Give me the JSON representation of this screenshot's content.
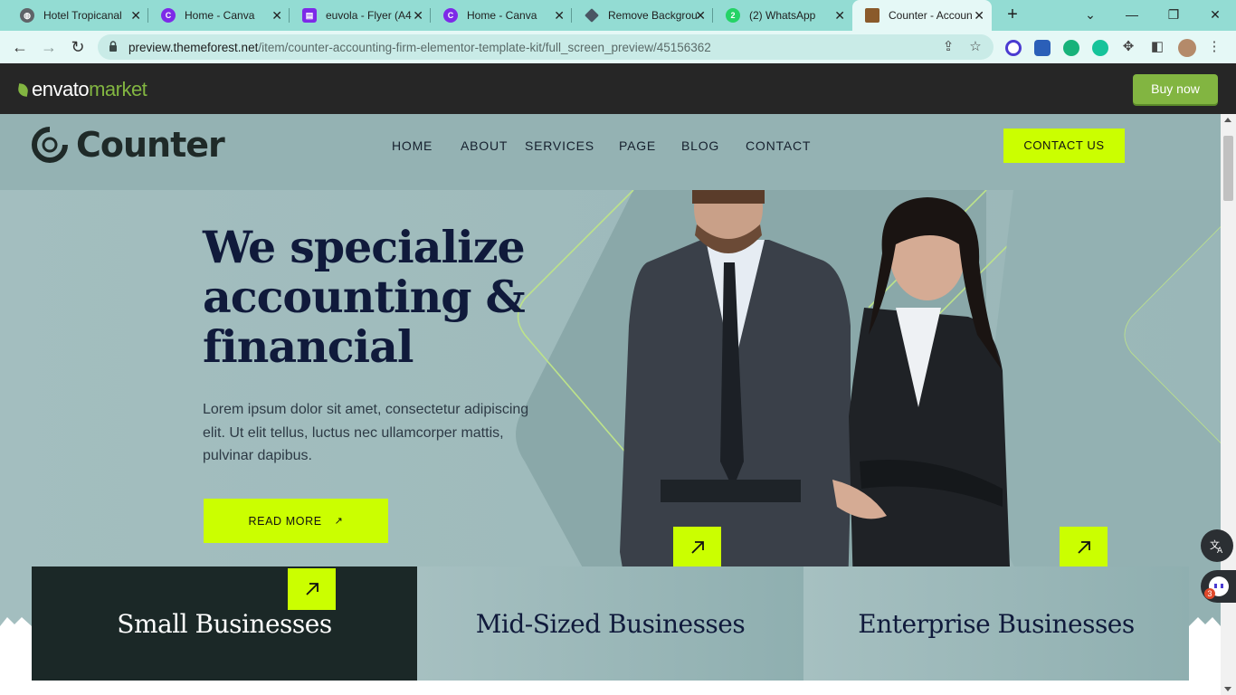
{
  "browser": {
    "tabs": [
      {
        "title": "Hotel Tropicanal",
        "favicon_color": "#5f6368",
        "favicon_glyph": "globe"
      },
      {
        "title": "Home - Canva",
        "favicon_color": "#7d2ae8",
        "favicon_glyph": "C"
      },
      {
        "title": "euvola - Flyer (A4",
        "favicon_color": "#7d2ae8",
        "favicon_glyph": "printer"
      },
      {
        "title": "Home - Canva",
        "favicon_color": "#7d2ae8",
        "favicon_glyph": "C"
      },
      {
        "title": "Remove Backgrou",
        "favicon_color": "#4a5563",
        "favicon_glyph": "diamond"
      },
      {
        "title": "(2) WhatsApp",
        "favicon_color": "#25d366",
        "favicon_glyph": "2"
      },
      {
        "title": "Counter - Accoun",
        "favicon_color": "#8a5a2b",
        "favicon_glyph": "photo"
      }
    ],
    "active_tab_index": 6,
    "url_domain": "preview.themeforest.net",
    "url_path": "/item/counter-accounting-firm-elementor-template-kit/full_screen_preview/45156362",
    "tab_close_glyph": "✕",
    "new_tab_glyph": "+",
    "window_controls": {
      "dropdown": "⌄",
      "minimize": "—",
      "restore": "❐",
      "close": "✕"
    },
    "nav": {
      "back": "←",
      "forward": "→",
      "reload": "↻"
    }
  },
  "envato": {
    "logo_main": "envato",
    "logo_accent": "market",
    "buy_now": "Buy now",
    "accent_color": "#82b541"
  },
  "site": {
    "brand": "Counter",
    "menu": [
      "HOME",
      "ABOUT",
      "SERVICES",
      "PAGE",
      "BLOG",
      "CONTACT"
    ],
    "contact_us": "CONTACT US",
    "headline_lines": [
      "We specialize",
      "accounting &",
      "financial"
    ],
    "lead": "Lorem ipsum dolor sit amet, consectetur adipiscing elit. Ut elit tellus, luctus nec ullamcorper mattis, pulvinar dapibus.",
    "read_more": "READ MORE",
    "read_more_arrow": "↗",
    "cards": [
      "Small Businesses",
      "Mid-Sized Businesses",
      "Enterprise Businesses"
    ],
    "accent_color": "#cbff00",
    "dark_color": "#1b2827"
  },
  "floating": {
    "translate_icon": "translate-icon",
    "assistant_badge": "3"
  }
}
